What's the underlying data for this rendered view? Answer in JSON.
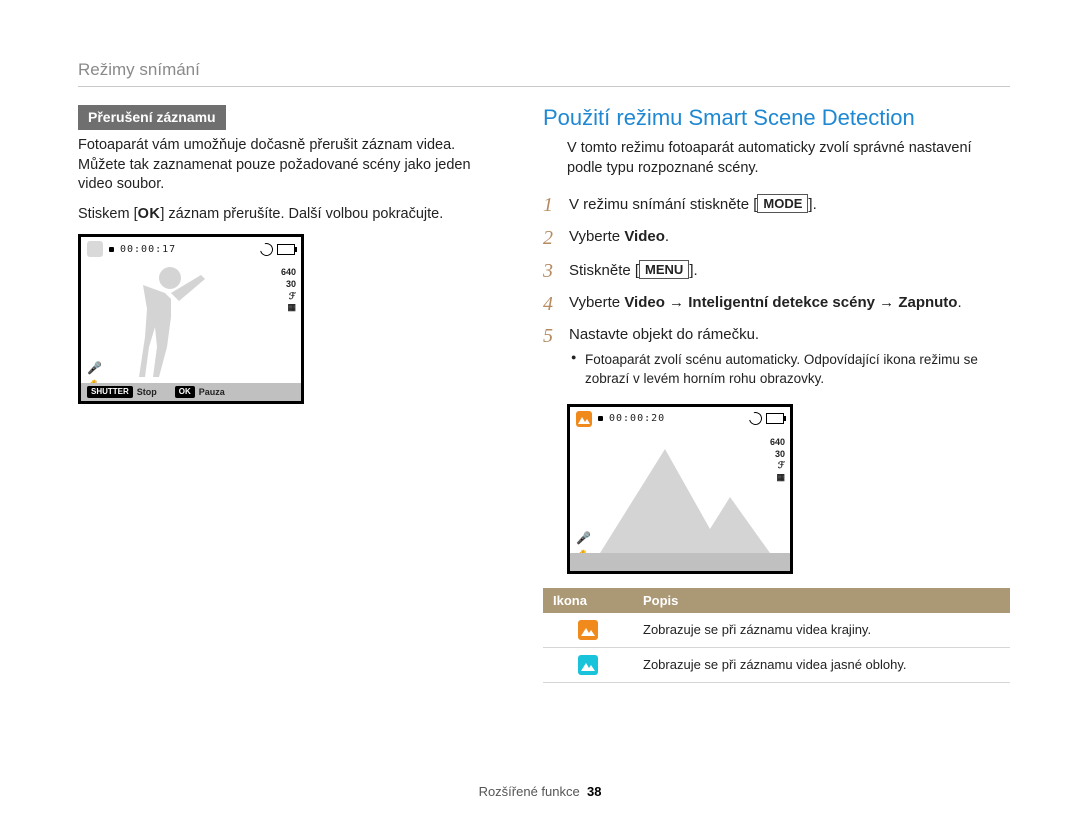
{
  "breadcrumb": "Režimy snímání",
  "left": {
    "tag": "Přerušení záznamu",
    "p1": "Fotoaparát vám umožňuje dočasně přerušit záznam videa. Můžete tak zaznamenat pouze požadované scény jako jeden video soubor.",
    "p2a": "Stiskem [",
    "p2_ok": "OK",
    "p2b": "] záznam přerušíte. Další volbou pokračujte.",
    "screen": {
      "timer": "00:00:17",
      "res": "640",
      "fps": "30",
      "bar_shutter": "SHUTTER",
      "bar_stop": "Stop",
      "bar_ok": "OK",
      "bar_pause": "Pauza"
    }
  },
  "right": {
    "heading": "Použití režimu Smart Scene Detection",
    "intro": "V tomto režimu fotoaparát automaticky zvolí správné nastavení podle typu rozpoznané scény.",
    "steps": {
      "s1a": "V režimu snímání stiskněte [",
      "s1_mode": "MODE",
      "s1b": "].",
      "s2a": "Vyberte ",
      "s2_bold": "Video",
      "s2b": ".",
      "s3a": "Stiskněte [",
      "s3_menu": "MENU",
      "s3b": "].",
      "s4a": "Vyberte ",
      "s4_b1": "Video",
      "s4_arrow1": " → ",
      "s4_b2": "Inteligentní detekce scény",
      "s4_arrow2": " → ",
      "s4_b3": "Zapnuto",
      "s4_end": ".",
      "s5": "Nastavte objekt do rámečku.",
      "s5_sub": "Fotoaparát zvolí scénu automaticky. Odpovídající ikona režimu se zobrazí v levém horním rohu obrazovky."
    },
    "screen": {
      "timer": "00:00:20",
      "res": "640",
      "fps": "30"
    },
    "table": {
      "h1": "Ikona",
      "h2": "Popis",
      "r1": "Zobrazuje se při záznamu videa krajiny.",
      "r2": "Zobrazuje se při záznamu videa jasné oblohy."
    }
  },
  "footer": {
    "label": "Rozšířené funkce",
    "page": "38"
  }
}
